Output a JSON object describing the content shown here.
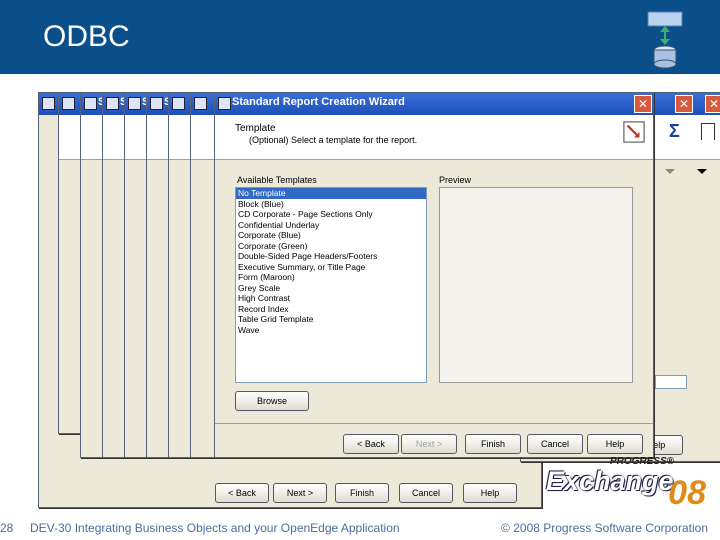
{
  "header": {
    "title": "ODBC"
  },
  "wizard": {
    "title": "Standard Report Creation Wizard",
    "behind_title_letter": "S",
    "section_title": "Template",
    "section_subtitle": "(Optional) Select a template for the report.",
    "available_label": "Available Templates",
    "preview_label": "Preview",
    "templates": [
      "No Template",
      "Block (Blue)",
      "CD Corporate - Page Sections Only",
      "Confidential Underlay",
      "Corporate (Blue)",
      "Corporate (Green)",
      "Double-Sided Page Headers/Footers",
      "Executive Summary, or Title Page",
      "Form (Maroon)",
      "Grey Scale",
      "High Contrast",
      "Record Index",
      "Table Grid Template",
      "Wave"
    ],
    "browse_label": "Browse",
    "back_label": "< Back",
    "next_label": "Next >",
    "finish_label": "Finish",
    "cancel_label": "Cancel",
    "help_label": "Help",
    "close_glyph": "✕"
  },
  "background_buttons": {
    "back_label": "< Back",
    "next_label": "Next >",
    "finish_label": "Finish",
    "cancel_label": "Cancel",
    "help_label": "Help",
    "side_help_label": "Help"
  },
  "side_icons": {
    "sum_glyph": "Σ"
  },
  "footer": {
    "slide_number": "28",
    "left_text": "DEV-30 Integrating Business Objects and your OpenEdge Application",
    "right_text": "© 2008 Progress Software Corporation"
  },
  "logo": {
    "progress": "PROGRESS®",
    "exchange": "Exchange",
    "year": "08"
  }
}
